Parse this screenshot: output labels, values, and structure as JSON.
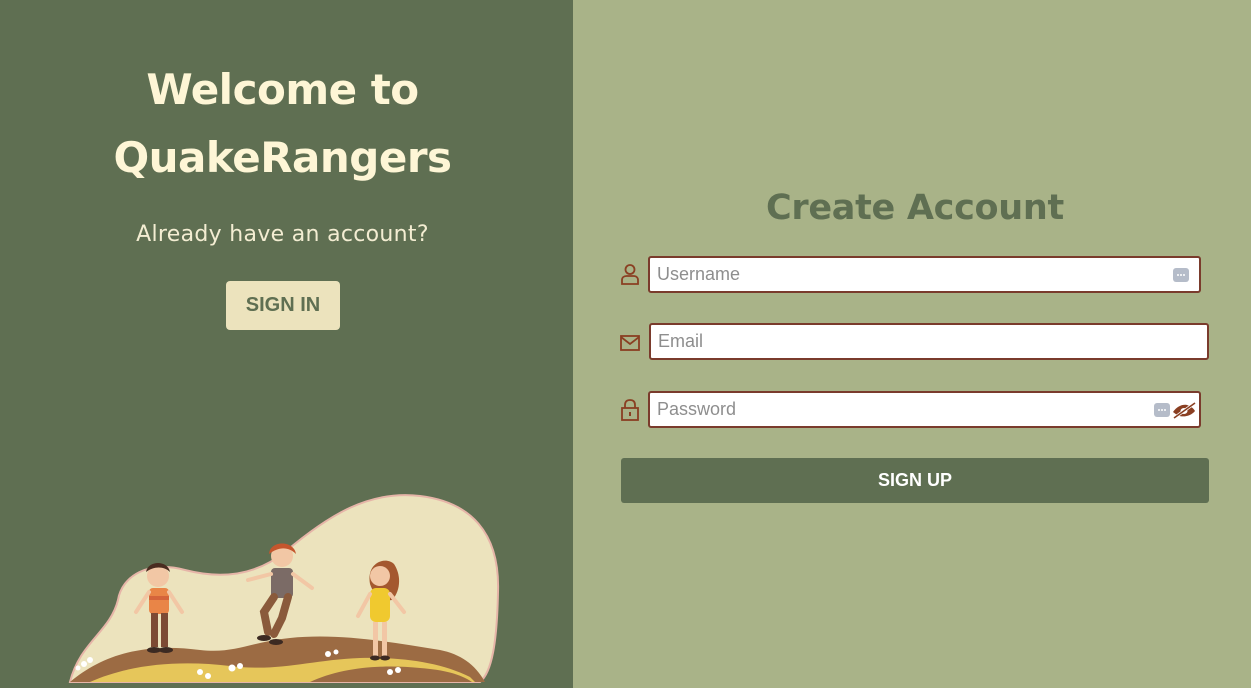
{
  "welcome": {
    "title_line1": "Welcome to",
    "title_line2": "QuakeRangers",
    "subtitle": "Already have an account?",
    "signin_label": "SIGN IN"
  },
  "form": {
    "title": "Create Account",
    "username": {
      "placeholder": "Username",
      "value": "",
      "icon": "user-icon"
    },
    "email": {
      "placeholder": "Email",
      "value": "",
      "icon": "envelope-icon"
    },
    "password": {
      "placeholder": "Password",
      "value": "",
      "icon": "lock-icon"
    },
    "signup_label": "SIGN UP"
  },
  "colors": {
    "left_panel": "#5f6f52",
    "right_panel": "#a9b388",
    "title_cream": "#fef6d6",
    "signin_bg": "#ece3bd",
    "field_border": "#7a3b2c",
    "icon_brown": "#8a3f22"
  }
}
